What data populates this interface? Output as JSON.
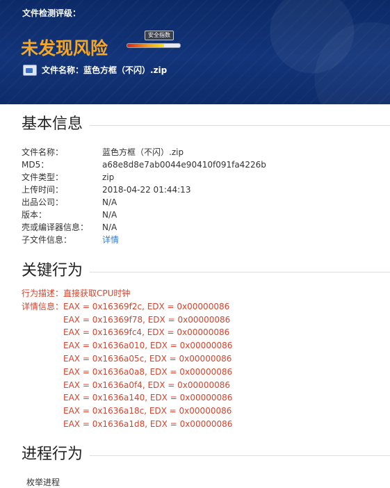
{
  "header": {
    "grade_label": "文件检测评级：",
    "verdict": "未发现风险",
    "meter_tag": "安全指数",
    "meter_level": 0.7,
    "filename_label": "文件名称：",
    "filename_value": "蓝色方框（不闪）.zip",
    "file_icon": "archive-file-icon"
  },
  "basic": {
    "title": "基本信息",
    "rows": [
      {
        "key": "文件名称：",
        "value": "蓝色方框（不闪）.zip"
      },
      {
        "key": "MD5：",
        "value": "a68e8d8e7ab0044e90410f091fa4226b"
      },
      {
        "key": "文件类型：",
        "value": "zip"
      },
      {
        "key": "上传时间：",
        "value": "2018-04-22 01:44:13"
      },
      {
        "key": "出品公司：",
        "value": "N/A"
      },
      {
        "key": "版本：",
        "value": "N/A"
      },
      {
        "key": "壳或编译器信息：",
        "value": "N/A"
      },
      {
        "key": "子文件信息：",
        "value": "详情"
      }
    ]
  },
  "key_behavior": {
    "title": "关键行为",
    "desc_label": "行为描述：",
    "desc_value": "直接获取CPU时钟",
    "detail_label": "详情信息：",
    "details": [
      "EAX = 0x16369f2c, EDX = 0x00000086",
      "EAX = 0x16369f78, EDX = 0x00000086",
      "EAX = 0x16369fc4, EDX = 0x00000086",
      "EAX = 0x1636a010, EDX = 0x00000086",
      "EAX = 0x1636a05c, EDX = 0x00000086",
      "EAX = 0x1636a0a8, EDX = 0x00000086",
      "EAX = 0x1636a0f4, EDX = 0x00000086",
      "EAX = 0x1636a140, EDX = 0x00000086",
      "EAX = 0x1636a18c, EDX = 0x00000086",
      "EAX = 0x1636a1d8, EDX = 0x00000086"
    ]
  },
  "process": {
    "title": "进程行为",
    "item": "枚举进程"
  },
  "colors": {
    "header_bg": "#12347a",
    "verdict": "#f5a623",
    "behavior_red": "#d9412b",
    "link": "#2b7fd6"
  }
}
